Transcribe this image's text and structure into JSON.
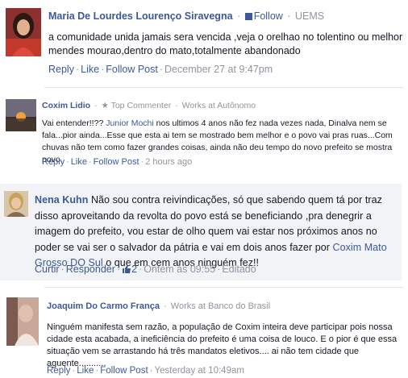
{
  "comments": [
    {
      "author": "Maria De Lourdes Lourenço Siravegna",
      "follow_label": "Follow",
      "affiliation": "UEMS",
      "text": "a comunidade unida jamais sera vencida ,veja o orelhao no tolentino ou melhor mendes mourao,dentro do mato,totalmente abandonado",
      "actions": {
        "reply": "Reply",
        "like": "Like",
        "follow_post": "Follow Post",
        "time": "December 27 at 9:47pm"
      }
    },
    {
      "author": "Coxim Lidio",
      "badge": "Top Commenter",
      "affiliation": "Works at Autônomo",
      "text_before": "Vai entender!!?? ",
      "mention": "Junior Mochi",
      "text_after": " nos ultimos 4 anos não fez nada vezes nada, Dinalva nem se fala...pior ainda...Esse que esta ai tem se mostrado bem melhor e o povo vai pras ruas...Com chuvas não tem como fazer grandes coisas, ainda não deu tempo do novo prefeito se mostra povo.",
      "actions": {
        "reply": "Reply",
        "like": "Like",
        "follow_post": "Follow Post",
        "time": "2 hours ago"
      }
    },
    {
      "author": "Nena Kuhn",
      "text_before": "Não sou contra reivindicações, só que sabendo quem tá por traz disso aproveitando da revolta do povo está se beneficiando ,pra denegrir a imagem do prefeito, vou estar de olho quem vai estar nos próximos anos no poder se vai ser o salvador da pátria e vai em dois anos fazer por ",
      "mention": "Coxim Mato Grosso DO Sul",
      "text_after": " o que em cem anos ninguém fez!!",
      "actions": {
        "reply": "Curtir",
        "like": "Responder",
        "like_count": "2",
        "time": "Ontem às 09:55",
        "edited": "Editado"
      }
    },
    {
      "author": "Joaquim Do Carmo França",
      "affiliation": "Works at Banco do Brasil",
      "text": "Ninguém manifesta sem razão, a população de Coxim inteira deve participar pois nossa cidade esta acabada, a ineficiência do prefeito é uma coisa de louco. E o pior é que essa situação vem se arrastando há três mandatos eletivos.... ai não tem cidade que aguente...........",
      "actions": {
        "reply": "Reply",
        "like": "Like",
        "follow_post": "Follow Post",
        "time": "Yesterday at 10:49am"
      }
    }
  ],
  "colors": {
    "link": "#3b5998",
    "meta": "#90949c",
    "highlight_bg": "#f2f3f7"
  }
}
